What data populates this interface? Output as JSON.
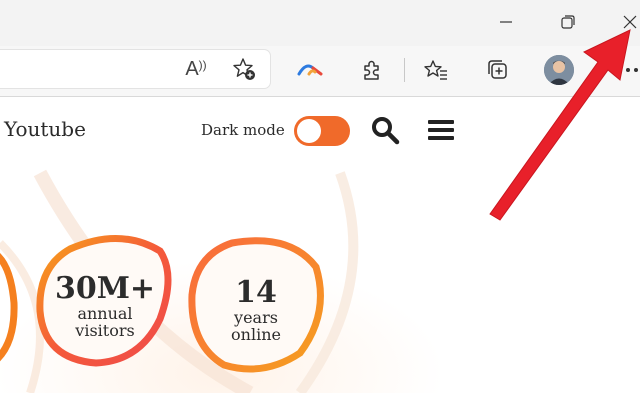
{
  "browser": {
    "window_controls": {
      "minimize": "minimize-icon",
      "restore": "restore-icon",
      "close": "close-icon"
    },
    "toolbar_icons": [
      "read-aloud-icon",
      "add-favorite-icon",
      "copilot-icon",
      "extensions-icon",
      "favorites-icon",
      "collections-icon",
      "profile-avatar",
      "more-icon"
    ],
    "read_aloud_glyph": "A"
  },
  "site": {
    "title": "Youtube",
    "dark_mode_label": "Dark mode",
    "dark_mode_on": false,
    "accent": "#f06a2a"
  },
  "stats": [
    {
      "number": "30M+",
      "line1": "annual",
      "line2": "visitors"
    },
    {
      "number": "14",
      "line1": "years",
      "line2": "online"
    }
  ],
  "annotation": {
    "arrow_color": "#e8202a",
    "points_to": "close-icon"
  }
}
